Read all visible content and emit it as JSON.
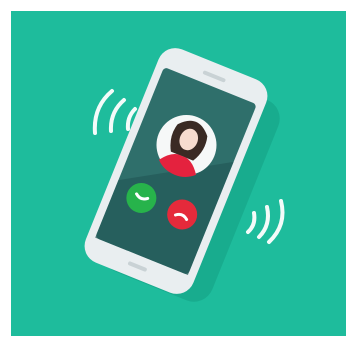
{
  "illustration": {
    "subject": "incoming-call-phone-illustration",
    "colors": {
      "background": "#1ebc9c",
      "phone_body": "#e9eef0",
      "phone_shadow": "#12987e",
      "screen": "#2f6f6b",
      "screen_dark": "#245a58",
      "avatar_ring": "#f6f8f8",
      "hair": "#3a2a24",
      "skin": "#f7dccf",
      "shirt": "#e4223e",
      "accept": "#27b34b",
      "decline": "#e52a3b",
      "waves": "#ffffff"
    },
    "icons": {
      "avatar": "user-avatar-icon",
      "accept": "accept-call-icon",
      "decline": "decline-call-icon",
      "vibration_left": "vibration-waves-left-icon",
      "vibration_right": "vibration-waves-right-icon"
    }
  }
}
